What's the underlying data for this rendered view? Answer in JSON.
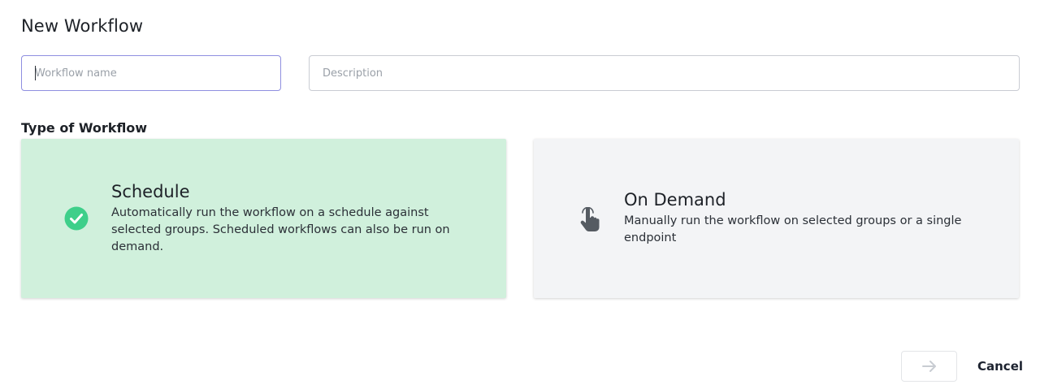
{
  "dialog": {
    "title": "New Workflow"
  },
  "form": {
    "name_placeholder": "Workflow name",
    "name_value": "",
    "description_placeholder": "Description",
    "description_value": ""
  },
  "workflow_type": {
    "label": "Type of Workflow",
    "options": [
      {
        "title": "Schedule",
        "description": "Automatically run the workflow on a schedule against selected groups. Scheduled workflows can also be run on demand.",
        "icon": "check-circle-icon",
        "selected": true
      },
      {
        "title": "On Demand",
        "description": "Manually run the workflow on selected groups or a single endpoint",
        "icon": "pointer-hand-icon",
        "selected": false
      }
    ]
  },
  "footer": {
    "next_icon": "arrow-right-icon",
    "cancel_label": "Cancel"
  },
  "colors": {
    "selected_card": "#d0f0dc",
    "unselected_card": "#f3f4f6",
    "check_accent": "#3ecf8a",
    "focus_border": "#8f8fe0"
  }
}
